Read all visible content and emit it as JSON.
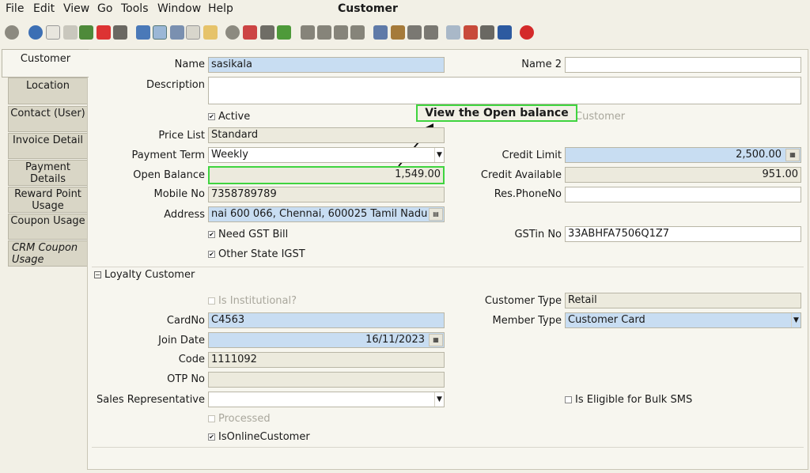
{
  "menu": {
    "file": "File",
    "edit": "Edit",
    "view": "View",
    "go": "Go",
    "tools": "Tools",
    "window": "Window",
    "help": "Help"
  },
  "window_title": "Customer",
  "tabs": [
    "Customer",
    "Location",
    "Contact (User)",
    "Invoice Detail",
    "Payment Details",
    "Reward Point Usage",
    "Coupon Usage",
    "CRM Coupon Usage"
  ],
  "callout": "View the Open balance",
  "form": {
    "name_label": "Name",
    "name_value": "sasikala",
    "name2_label": "Name 2",
    "name2_value": "",
    "description_label": "Description",
    "description_value": "",
    "active_label": "Active",
    "customer_label": "Customer",
    "price_list_label": "Price List",
    "price_list_value": "Standard",
    "payment_term_label": "Payment Term",
    "payment_term_value": "Weekly",
    "credit_limit_label": "Credit Limit",
    "credit_limit_value": "2,500.00",
    "open_balance_label": "Open Balance",
    "open_balance_value": "1,549.00",
    "credit_available_label": "Credit Available",
    "credit_available_value": "951.00",
    "mobile_label": "Mobile No",
    "mobile_value": "7358789789",
    "res_phone_label": "Res.PhoneNo",
    "res_phone_value": "",
    "address_label": "Address",
    "address_value": "nai 600 066, Chennai,  600025 Tamil Nadu",
    "need_gst_label": "Need GST Bill",
    "gstin_label": "GSTin No",
    "gstin_value": "33ABHFA7506Q1Z7",
    "other_state_label": "Other State IGST"
  },
  "loyalty": {
    "section_title": "Loyalty Customer",
    "institutional_label": "Is Institutional?",
    "customer_type_label": "Customer Type",
    "customer_type_value": "Retail",
    "cardno_label": "CardNo",
    "cardno_value": "C4563",
    "member_type_label": "Member Type",
    "member_type_value": "Customer Card",
    "join_date_label": "Join Date",
    "join_date_value": "16/11/2023",
    "code_label": "Code",
    "code_value": "1111092",
    "otp_label": "OTP No",
    "otp_value": "",
    "sales_rep_label": "Sales Representative",
    "sales_rep_value": "",
    "bulk_sms_label": "Is Eligible for Bulk SMS",
    "processed_label": "Processed",
    "online_label": "IsOnlineCustomer"
  }
}
